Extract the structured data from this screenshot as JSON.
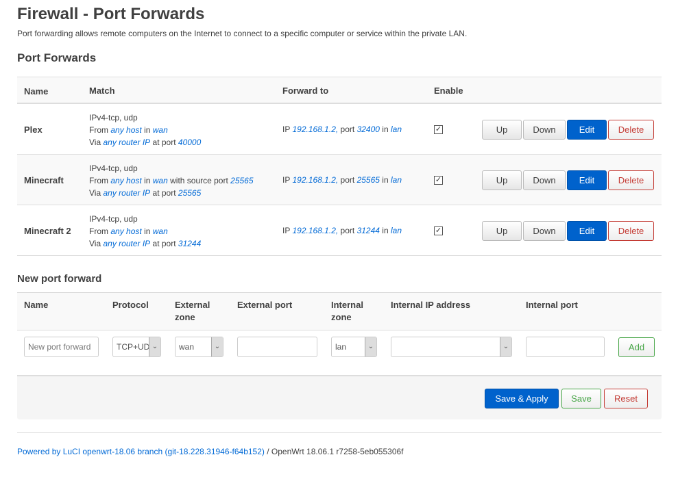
{
  "title": "Firewall - Port Forwards",
  "description": "Port forwarding allows remote computers on the Internet to connect to a specific computer or service within the private LAN.",
  "section_title": "Port Forwards",
  "columns": {
    "name": "Name",
    "match": "Match",
    "forward": "Forward to",
    "enable": "Enable"
  },
  "words": {
    "from": "From",
    "in": "in",
    "via": "Via",
    "at_port": "at port",
    "with_src": "with source port",
    "ip": "IP",
    "port": "port"
  },
  "rules": [
    {
      "name": "Plex",
      "proto": "IPv4-tcp, udp",
      "src_host": "any host",
      "src_zone": "wan",
      "src_port": "",
      "router_ip": "any router IP",
      "ext_port": "40000",
      "dest_ip": "192.168.1.2,",
      "dest_port": "32400",
      "dest_zone": "lan",
      "enabled": true
    },
    {
      "name": "Minecraft",
      "proto": "IPv4-tcp, udp",
      "src_host": "any host",
      "src_zone": "wan",
      "src_port": "25565",
      "router_ip": "any router IP",
      "ext_port": "25565",
      "dest_ip": "192.168.1.2,",
      "dest_port": "25565",
      "dest_zone": "lan",
      "enabled": true
    },
    {
      "name": "Minecraft 2",
      "proto": "IPv4-tcp, udp",
      "src_host": "any host",
      "src_zone": "wan",
      "src_port": "",
      "router_ip": "any router IP",
      "ext_port": "31244",
      "dest_ip": "192.168.1.2,",
      "dest_port": "31244",
      "dest_zone": "lan",
      "enabled": true
    }
  ],
  "buttons": {
    "up": "Up",
    "down": "Down",
    "edit": "Edit",
    "delete": "Delete",
    "add": "Add",
    "save_apply": "Save & Apply",
    "save": "Save",
    "reset": "Reset"
  },
  "new_section": {
    "title": "New port forward",
    "columns": {
      "name": "Name",
      "protocol": "Protocol",
      "ext_zone": "External zone",
      "ext_port": "External port",
      "int_zone": "Internal zone",
      "int_ip": "Internal IP address",
      "int_port": "Internal port"
    },
    "name_placeholder": "New port forward",
    "protocol": "TCP+UDP",
    "ext_zone": "wan",
    "ext_port": "",
    "int_zone": "lan",
    "int_ip": "",
    "int_port": ""
  },
  "footer": {
    "powered": "Powered by LuCI openwrt-18.06 branch (git-18.228.31946-f64b152)",
    "version": " / OpenWrt 18.06.1 r7258-5eb055306f"
  },
  "colors": {
    "link": "#0069d6",
    "primary": "#0062cc",
    "danger": "#c43c35",
    "success": "#46a546"
  }
}
